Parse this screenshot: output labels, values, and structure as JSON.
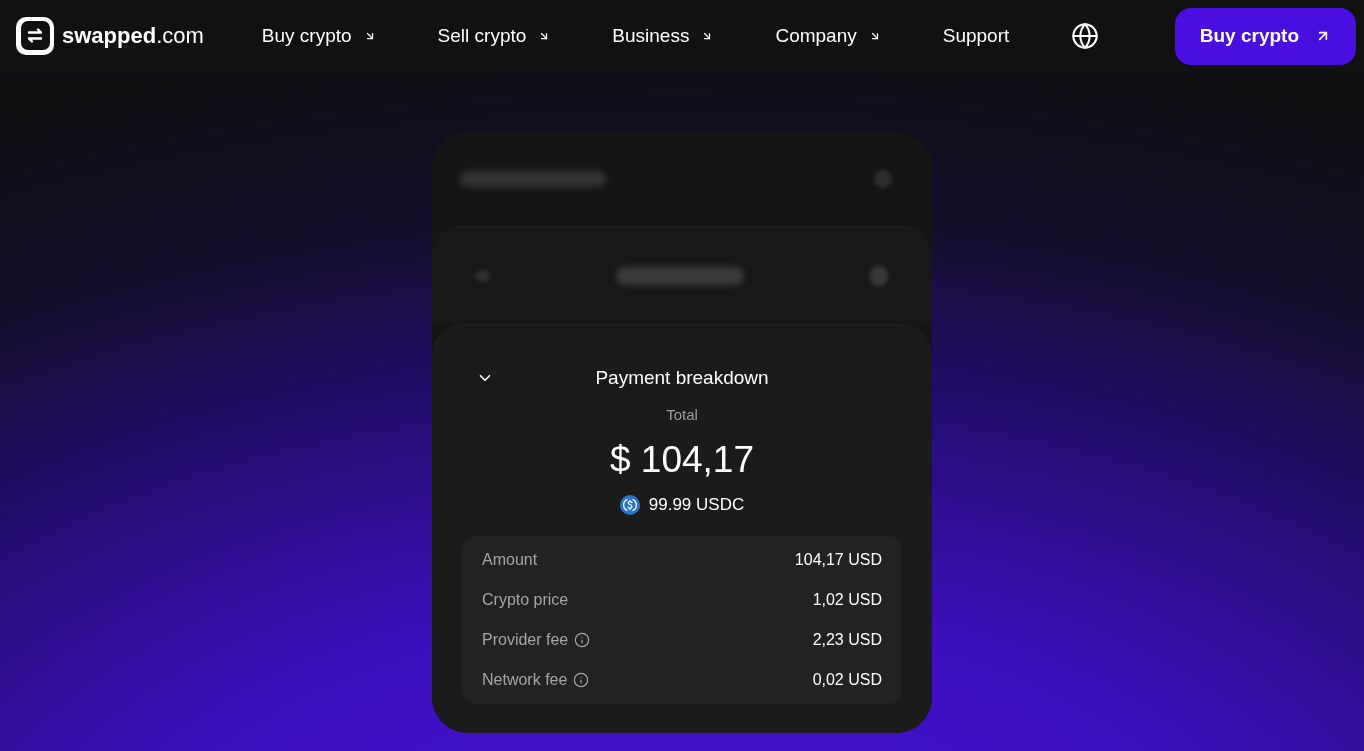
{
  "header": {
    "logo": "**swapped**.com",
    "nav": [
      {
        "label": "Buy crypto",
        "kind": "dropdown"
      },
      {
        "label": "Sell crypto",
        "kind": "dropdown"
      },
      {
        "label": "Business",
        "kind": "dropdown"
      },
      {
        "label": "Company",
        "kind": "dropdown"
      },
      {
        "label": "Support",
        "kind": "link"
      }
    ],
    "cta": "Buy crypto"
  },
  "breakdown": {
    "title": "Payment breakdown",
    "expanded": true,
    "total_label": "Total",
    "total": "$ 104,17",
    "crypto_amount": "99.99 USDC",
    "rows": [
      {
        "label": "Amount",
        "value": "104,17 USD",
        "info": false
      },
      {
        "label": "Crypto price",
        "value": "1,02 USD",
        "info": false
      },
      {
        "label": "Provider fee",
        "value": "2,23 USD",
        "info": true
      },
      {
        "label": "Network fee",
        "value": "0,02 USD",
        "info": true
      }
    ]
  }
}
